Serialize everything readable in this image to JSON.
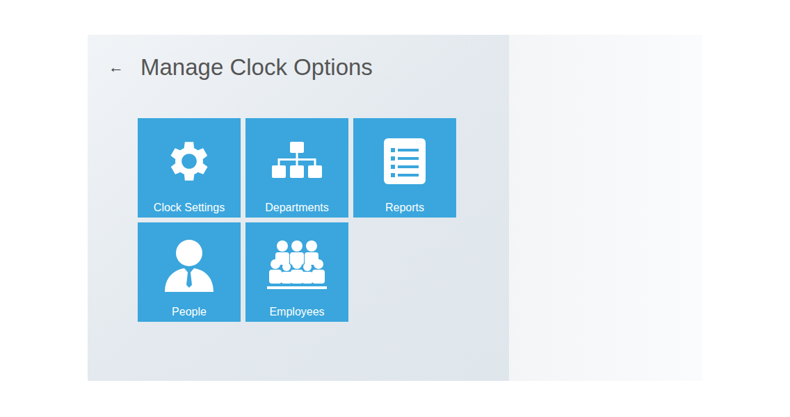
{
  "header": {
    "back_icon": "←",
    "title": "Manage Clock Options"
  },
  "tiles": [
    {
      "label": "Clock Settings"
    },
    {
      "label": "Departments"
    },
    {
      "label": "Reports"
    },
    {
      "label": "People"
    },
    {
      "label": "Employees"
    }
  ]
}
